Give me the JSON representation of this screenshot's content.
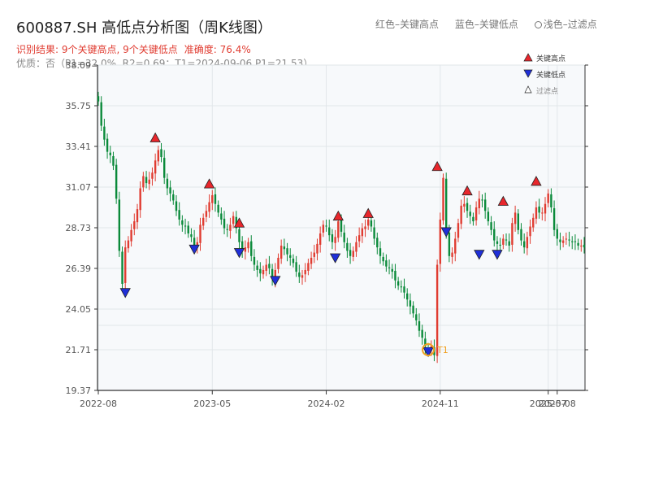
{
  "header": {
    "title": "600887.SH 高低点分析图（周K线图）",
    "legend_red": "红色–关键高点",
    "legend_blue": "蓝色–关键低点",
    "legend_light": "浅色–过滤点",
    "result_text": "识别结果: 9个关键高点, 9个关键低点",
    "accuracy_text": "准确度: 76.4%",
    "quality_text": "优质：否（P1=32.0%, R2=0.69；T1=2024-09-06 P1=21.53）"
  },
  "colors": {
    "up": "#e03c31",
    "down": "#0a8a3a",
    "high_marker": "#e8262c",
    "low_marker": "#1f2fd8",
    "t1_ring": "#f0a020",
    "plot_bg": "#f7f9fb"
  },
  "chart_data": {
    "type": "candlestick",
    "title": "600887.SH 高低点分析图（周K线图）",
    "y_ticks": [
      "19.37",
      "21.71",
      "24.05",
      "26.39",
      "28.73",
      "31.07",
      "33.41",
      "35.75",
      "38.09"
    ],
    "ylim": [
      19.37,
      38.09
    ],
    "x_ticks": [
      {
        "label": "2022-08",
        "idx": 0
      },
      {
        "label": "2023-05",
        "idx": 38
      },
      {
        "label": "2024-02",
        "idx": 76
      },
      {
        "label": "2024-11",
        "idx": 114
      },
      {
        "label": "2025-07",
        "idx": 150
      },
      {
        "label": "2025-08",
        "idx": 153
      }
    ],
    "grid": true,
    "close_series": [
      36.0,
      34.6,
      33.8,
      33.1,
      32.9,
      32.3,
      30.4,
      27.4,
      25.5,
      27.6,
      28.0,
      28.6,
      29.1,
      29.8,
      31.0,
      31.7,
      31.3,
      31.5,
      31.9,
      32.6,
      33.2,
      32.8,
      31.6,
      31.0,
      30.7,
      30.3,
      29.7,
      29.2,
      28.9,
      28.8,
      28.4,
      28.2,
      27.6,
      27.9,
      28.9,
      29.3,
      29.7,
      30.2,
      30.6,
      30.1,
      29.6,
      29.2,
      28.7,
      28.6,
      28.9,
      29.4,
      28.7,
      27.9,
      27.4,
      27.6,
      27.9,
      27.1,
      26.6,
      26.3,
      26.1,
      26.3,
      26.6,
      26.4,
      25.8,
      26.3,
      27.0,
      27.7,
      27.5,
      27.2,
      27.0,
      26.7,
      26.2,
      25.9,
      26.0,
      26.3,
      26.7,
      27.0,
      27.3,
      27.8,
      28.4,
      28.9,
      28.8,
      28.3,
      27.9,
      28.2,
      29.1,
      28.5,
      27.9,
      27.4,
      27.1,
      27.4,
      27.9,
      28.3,
      28.7,
      28.8,
      29.2,
      28.8,
      28.1,
      27.6,
      27.1,
      26.8,
      26.5,
      26.4,
      26.2,
      25.7,
      25.4,
      25.3,
      25.0,
      24.6,
      24.2,
      23.8,
      23.4,
      22.8,
      22.4,
      21.9,
      21.6,
      21.9,
      21.4,
      26.6,
      29.2,
      31.6,
      28.4,
      27.1,
      27.3,
      28.1,
      29.0,
      30.0,
      30.1,
      29.7,
      29.4,
      29.1,
      29.9,
      30.4,
      30.3,
      29.7,
      29.1,
      28.6,
      28.0,
      27.8,
      27.7,
      28.1,
      28.0,
      27.7,
      29.0,
      29.6,
      28.6,
      28.0,
      27.6,
      28.2,
      28.8,
      29.3,
      29.9,
      29.6,
      29.6,
      30.1,
      30.7,
      29.9,
      28.6,
      28.1,
      27.9,
      28.0,
      28.1,
      28.0,
      27.9,
      27.9,
      27.7,
      27.7,
      27.6
    ],
    "key_highs": [
      {
        "idx": 19,
        "value": 33.9
      },
      {
        "idx": 37,
        "value": 31.25
      },
      {
        "idx": 47,
        "value": 29.0
      },
      {
        "idx": 80,
        "value": 29.4
      },
      {
        "idx": 90,
        "value": 29.55
      },
      {
        "idx": 113,
        "value": 32.25
      },
      {
        "idx": 123,
        "value": 30.85
      },
      {
        "idx": 135,
        "value": 30.25
      },
      {
        "idx": 146,
        "value": 31.4
      }
    ],
    "key_lows": [
      {
        "idx": 9,
        "value": 25.0
      },
      {
        "idx": 32,
        "value": 27.5
      },
      {
        "idx": 47,
        "value": 27.3
      },
      {
        "idx": 59,
        "value": 25.7
      },
      {
        "idx": 79,
        "value": 27.0
      },
      {
        "idx": 110,
        "value": 21.6
      },
      {
        "idx": 116,
        "value": 28.5
      },
      {
        "idx": 127,
        "value": 27.2
      },
      {
        "idx": 133,
        "value": 27.2
      }
    ],
    "t1": {
      "label": "T1",
      "idx": 110,
      "value": 21.71
    },
    "legend": {
      "high": "关键高点",
      "low": "关键低点",
      "filtered": "过滤点"
    }
  }
}
